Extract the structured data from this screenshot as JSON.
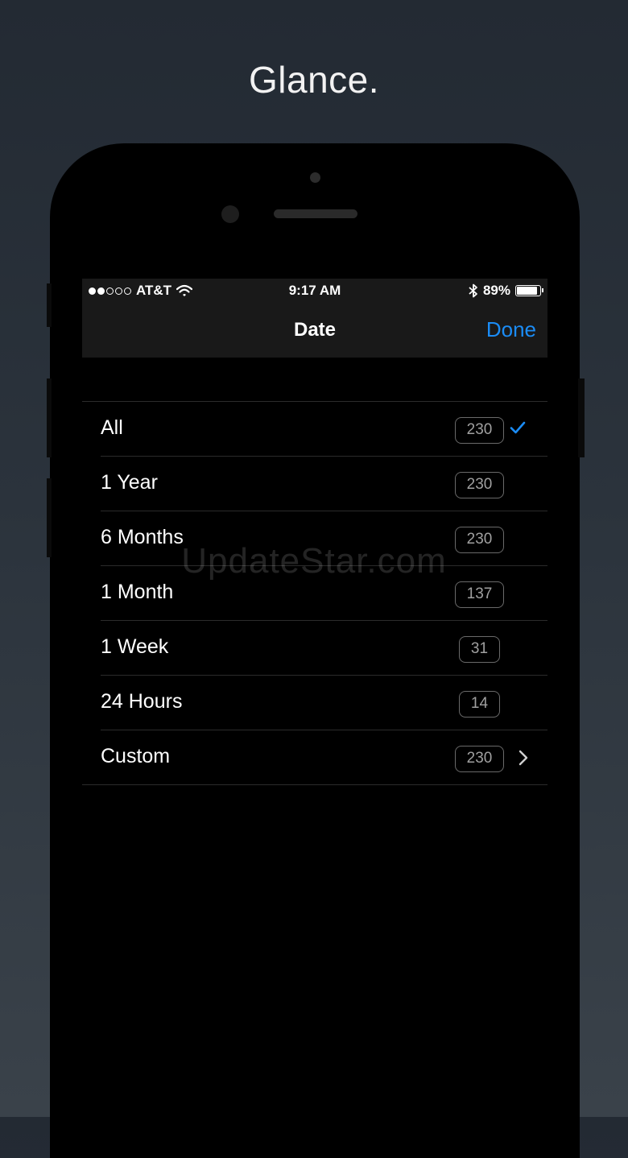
{
  "headline": "Glance.",
  "status_bar": {
    "carrier": "AT&T",
    "time": "9:17 AM",
    "battery": "89%",
    "battery_level": 0.89,
    "signal_bars_filled": 2,
    "signal_bars_total": 5
  },
  "nav": {
    "title": "Date",
    "done_label": "Done"
  },
  "rows": [
    {
      "label": "All",
      "count": "230",
      "accessory": "checkmark"
    },
    {
      "label": "1 Year",
      "count": "230",
      "accessory": "none"
    },
    {
      "label": "6 Months",
      "count": "230",
      "accessory": "none"
    },
    {
      "label": "1 Month",
      "count": "137",
      "accessory": "none"
    },
    {
      "label": "1 Week",
      "count": "31",
      "accessory": "none"
    },
    {
      "label": "24 Hours",
      "count": "14",
      "accessory": "none"
    },
    {
      "label": "Custom",
      "count": "230",
      "accessory": "chevron"
    }
  ],
  "watermark": "UpdateStar.com",
  "colors": {
    "accent": "#1b8cf5",
    "bar_background": "#191919",
    "separator": "#2b2b2b"
  }
}
